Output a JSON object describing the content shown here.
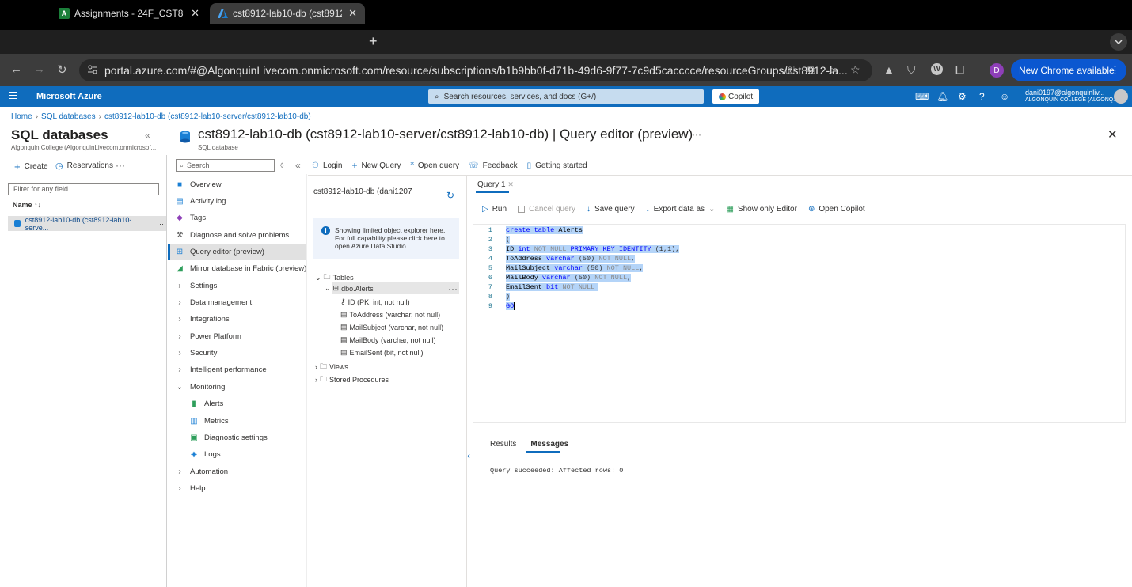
{
  "browser": {
    "tabs": [
      {
        "label": "Assignments - 24F_CST8912_",
        "close": "✕"
      },
      {
        "label": "cst8912-lab10-db (cst8912-l",
        "close": "✕"
      }
    ],
    "new_tab": "+",
    "url": "portal.azure.com/#@AlgonquinLivecom.onmicrosoft.com/resource/subscriptions/b1b9bb0f-d71b-49d6-9f77-7c9d5cacccce/resourceGroups/cst8912-la...",
    "profile_initial": "D",
    "update_label": "New Chrome available"
  },
  "azure": {
    "brand": "Microsoft Azure",
    "search_placeholder": "Search resources, services, and docs (G+/)",
    "copilot": "Copilot",
    "account_name": "dani0197@algonquinliv...",
    "account_org": "ALGONQUIN COLLEGE (ALGONQ..."
  },
  "breadcrumb": [
    "Home",
    "SQL databases",
    "cst8912-lab10-db (cst8912-lab10-server/cst8912-lab10-db)"
  ],
  "left_blade": {
    "title": "SQL databases",
    "subtitle": "Algonquin College (AlgonquinLivecom.onmicrosof...",
    "create": "Create",
    "reservations": "Reservations",
    "filter_placeholder": "Filter for any field...",
    "name_header": "Name",
    "db_row": "cst8912-lab10-db (cst8912-lab10-serve..."
  },
  "main": {
    "title": "cst8912-lab10-db (cst8912-lab10-server/cst8912-lab10-db) | Query editor (preview)",
    "subtitle": "SQL database",
    "search_placeholder": "Search",
    "menu": [
      {
        "label": "Overview",
        "icon": "database-icon"
      },
      {
        "label": "Activity log",
        "icon": "activity-log-icon"
      },
      {
        "label": "Tags",
        "icon": "tag-icon"
      },
      {
        "label": "Diagnose and solve problems",
        "icon": "wrench-icon"
      },
      {
        "label": "Query editor (preview)",
        "icon": "query-editor-icon"
      },
      {
        "label": "Mirror database in Fabric (preview)",
        "icon": "fabric-icon"
      },
      {
        "label": "Settings",
        "icon": "chevron-right-icon"
      },
      {
        "label": "Data management",
        "icon": "chevron-right-icon"
      },
      {
        "label": "Integrations",
        "icon": "chevron-right-icon"
      },
      {
        "label": "Power Platform",
        "icon": "chevron-right-icon"
      },
      {
        "label": "Security",
        "icon": "chevron-right-icon"
      },
      {
        "label": "Intelligent performance",
        "icon": "chevron-right-icon"
      },
      {
        "label": "Monitoring",
        "icon": "chevron-down-icon"
      },
      {
        "label": "Alerts",
        "icon": "alerts-icon"
      },
      {
        "label": "Metrics",
        "icon": "metrics-icon"
      },
      {
        "label": "Diagnostic settings",
        "icon": "diagnostic-icon"
      },
      {
        "label": "Logs",
        "icon": "logs-icon"
      },
      {
        "label": "Automation",
        "icon": "chevron-right-icon"
      },
      {
        "label": "Help",
        "icon": "chevron-right-icon"
      }
    ],
    "toolbar": [
      "Login",
      "New Query",
      "Open query",
      "Feedback",
      "Getting started"
    ]
  },
  "explorer": {
    "db_name": "cst8912-lab10-db (dani1207",
    "info": "Showing limited object explorer here. For full capability please click here to open Azure Data Studio.",
    "tables": "Tables",
    "table": "dbo.Alerts",
    "columns": [
      "ID (PK, int, not null)",
      "ToAddress (varchar, not null)",
      "MailSubject (varchar, not null)",
      "MailBody (varchar, not null)",
      "EmailSent (bit, not null)"
    ],
    "views": "Views",
    "procs": "Stored Procedures"
  },
  "editor": {
    "tab": "Query 1",
    "run": "Run",
    "cancel": "Cancel query",
    "save": "Save query",
    "export": "Export data as",
    "show_only": "Show only Editor",
    "copilot": "Open Copilot",
    "line_numbers": [
      "1",
      "2",
      "3",
      "4",
      "5",
      "6",
      "7",
      "8",
      "9"
    ],
    "results_tab": "Results",
    "messages_tab": "Messages",
    "message": "Query succeeded: Affected rows: 0"
  }
}
